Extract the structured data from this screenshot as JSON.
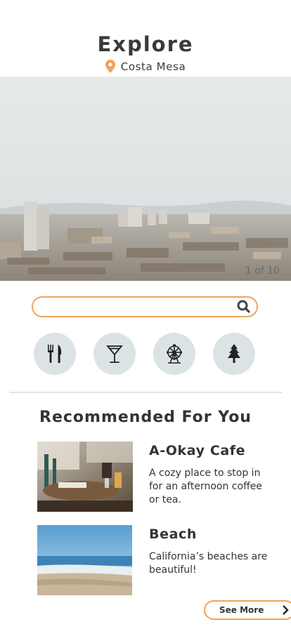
{
  "header": {
    "title": "Explore",
    "location": "Costa Mesa",
    "location_icon": "map-pin-icon"
  },
  "hero": {
    "counter": "1 of 10"
  },
  "search": {
    "placeholder": "",
    "icon": "search-icon"
  },
  "categories": [
    {
      "name": "restaurants",
      "icon": "fork-knife-icon"
    },
    {
      "name": "bars",
      "icon": "cocktail-icon"
    },
    {
      "name": "attractions",
      "icon": "ferris-wheel-icon"
    },
    {
      "name": "nature",
      "icon": "pine-tree-icon"
    }
  ],
  "recommended": {
    "title": "Recommended For You",
    "items": [
      {
        "title": "A-Okay Cafe",
        "description": "A cozy place to stop in for an afternoon coffee or tea."
      },
      {
        "title": "Beach",
        "description": "California’s beaches are beautiful!"
      }
    ],
    "see_more": "See More"
  },
  "colors": {
    "accent": "#f0a358",
    "category_bg": "#dce3e5",
    "text": "#333333"
  }
}
